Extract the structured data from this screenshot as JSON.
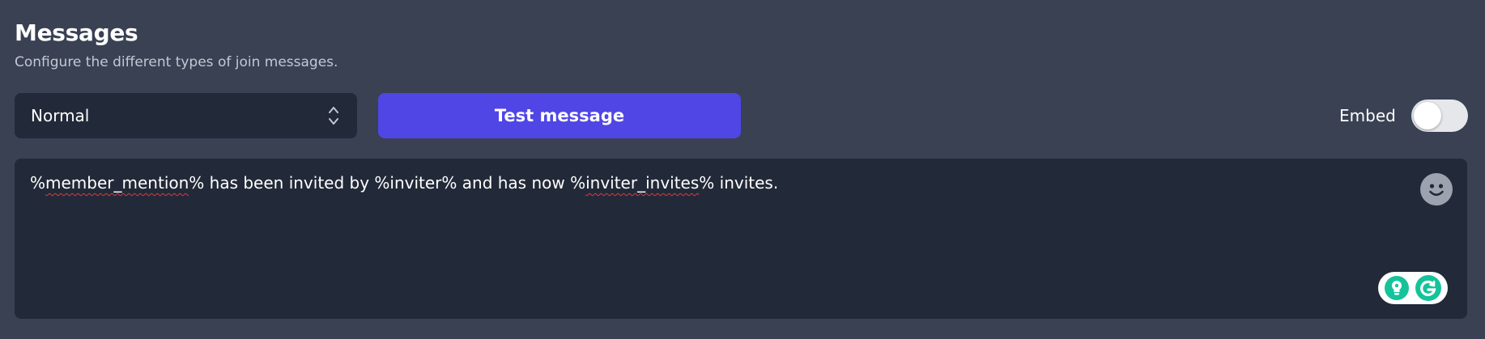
{
  "header": {
    "title": "Messages",
    "subtitle": "Configure the different types of join messages."
  },
  "message_type_select": {
    "value": "Normal",
    "icon": "up-down-chevron-icon"
  },
  "test_button": {
    "label": "Test message"
  },
  "embed": {
    "label": "Embed",
    "enabled": false
  },
  "message_editor": {
    "segments": [
      {
        "text": "%",
        "misspelled": false
      },
      {
        "text": "member_mention",
        "misspelled": true
      },
      {
        "text": "% has been invited by %inviter% and has now %",
        "misspelled": false
      },
      {
        "text": "inviter_invites",
        "misspelled": true
      },
      {
        "text": "% invites.",
        "misspelled": false
      }
    ],
    "emoji_icon": "smiley-face-icon",
    "assistant_icons": [
      "lightbulb-icon",
      "grammarly-icon"
    ]
  },
  "colors": {
    "page_background": "#394153",
    "panel_background": "#222938",
    "accent": "#5046e5",
    "assistant_green": "#15c39a"
  }
}
